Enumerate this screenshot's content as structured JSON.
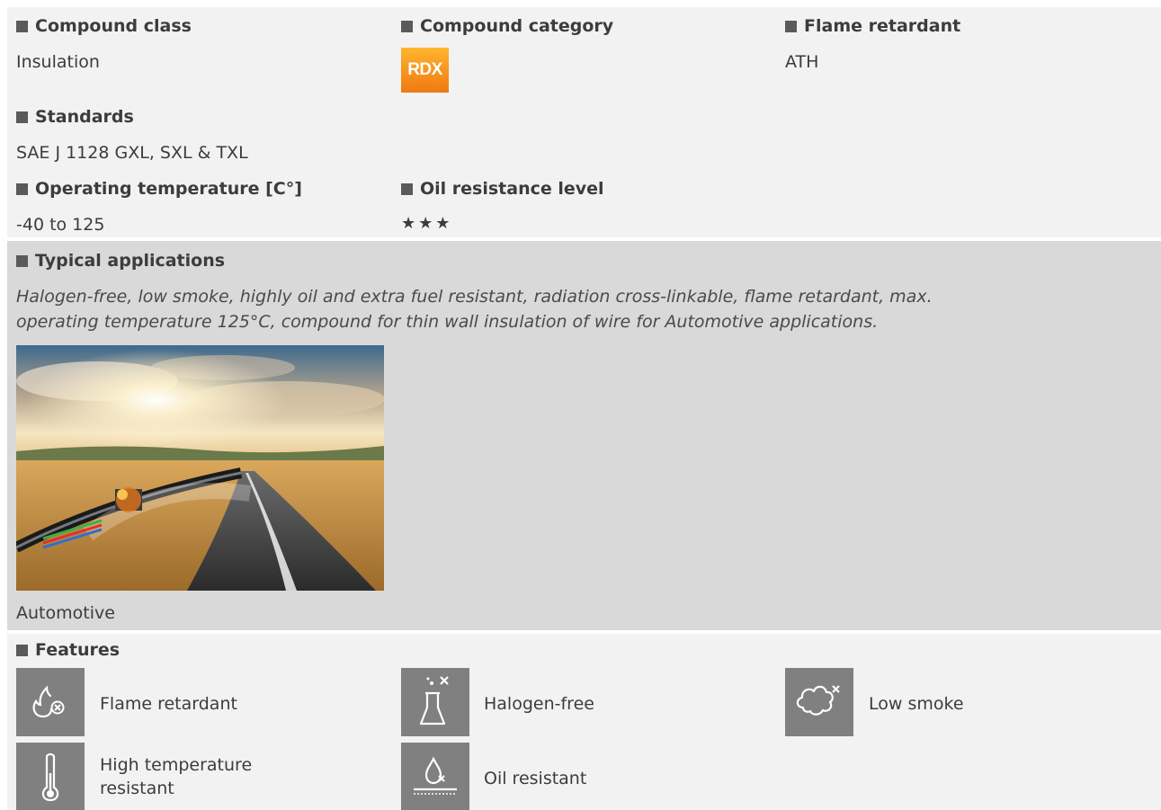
{
  "compound_class": {
    "label": "Compound class",
    "value": "Insulation"
  },
  "compound_category": {
    "label": "Compound category",
    "badge": "RDX",
    "badge_color": "#f7931e"
  },
  "flame_retardant": {
    "label": "Flame retardant",
    "value": "ATH"
  },
  "standards": {
    "label": "Standards",
    "value": "SAE J 1128 GXL, SXL & TXL"
  },
  "operating_temperature": {
    "label": "Operating temperature [C°]",
    "value": "-40 to 125"
  },
  "oil_resistance": {
    "label": "Oil resistance level",
    "stars": "★★★",
    "level": 3
  },
  "typical_applications": {
    "label": "Typical applications",
    "line1": "Halogen-free, low smoke, highly oil and extra fuel resistant, radiation cross-linkable, flame retardant, max.",
    "line2": "operating temperature 125°C, compound for thin wall insulation of wire for Automotive applications.",
    "image_caption": "Automotive"
  },
  "features": {
    "label": "Features",
    "items": [
      {
        "icon": "flame-retardant-icon",
        "label": "Flame retardant"
      },
      {
        "icon": "halogen-free-icon",
        "label": "Halogen-free"
      },
      {
        "icon": "low-smoke-icon",
        "label": "Low smoke"
      },
      {
        "icon": "high-temperature-icon",
        "label_line1": "High temperature",
        "label_line2": "resistant"
      },
      {
        "icon": "oil-resistant-icon",
        "label": "Oil resistant"
      }
    ]
  },
  "colors": {
    "section_light": "#f2f2f2",
    "section_gray": "#d9d9d9",
    "icon_bg": "#808080",
    "text": "#3c3c3c"
  }
}
